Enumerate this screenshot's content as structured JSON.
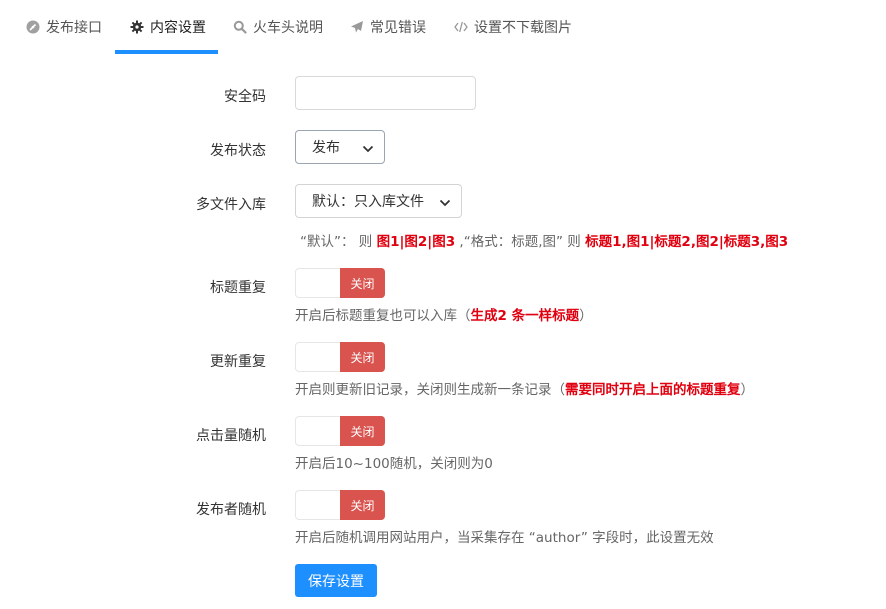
{
  "tabs": [
    {
      "label": "发布接口",
      "icon": "dashboard-icon"
    },
    {
      "label": "内容设置",
      "icon": "gear-icon"
    },
    {
      "label": "火车头说明",
      "icon": "search-icon"
    },
    {
      "label": "常见错误",
      "icon": "paper-plane-icon"
    },
    {
      "label": "设置不下载图片",
      "icon": "code-icon"
    }
  ],
  "active_tab": "内容设置",
  "form": {
    "security_code": {
      "label": "安全码",
      "value": ""
    },
    "publish_status": {
      "label": "发布状态",
      "value": "发布"
    },
    "multi_file": {
      "label": "多文件入库",
      "value": "默认：只入库文件",
      "help": {
        "t1": "“默认”：  则 ",
        "b1": "图1|图2|图3",
        "t2": " ,“格式：标题,图”  则 ",
        "b2": "标题1,图1|标题2,图2|标题3,图3"
      }
    },
    "title_repeat": {
      "label": "标题重复",
      "toggle": "关闭",
      "help": {
        "t1": "开启后标题重复也可以入库（",
        "b1": "生成2 条一样标题",
        "t2": "）"
      }
    },
    "update_repeat": {
      "label": "更新重复",
      "toggle": "关闭",
      "help": {
        "t1": "开启则更新旧记录，关闭则生成新一条记录（",
        "b1": "需要同时开启上面的标题重复",
        "t2": "）"
      }
    },
    "click_random": {
      "label": "点击量随机",
      "toggle": "关闭",
      "help": "开启后10~100随机，关闭则为0"
    },
    "author_random": {
      "label": "发布者随机",
      "toggle": "关闭",
      "help": "开启后随机调用网站用户，当采集存在 “author” 字段时，此设置无效"
    }
  },
  "save_label": "保存设置",
  "colors": {
    "accent": "#1e8fff",
    "toggle_off": "#d9534f",
    "emphasis": "#e0000f"
  }
}
